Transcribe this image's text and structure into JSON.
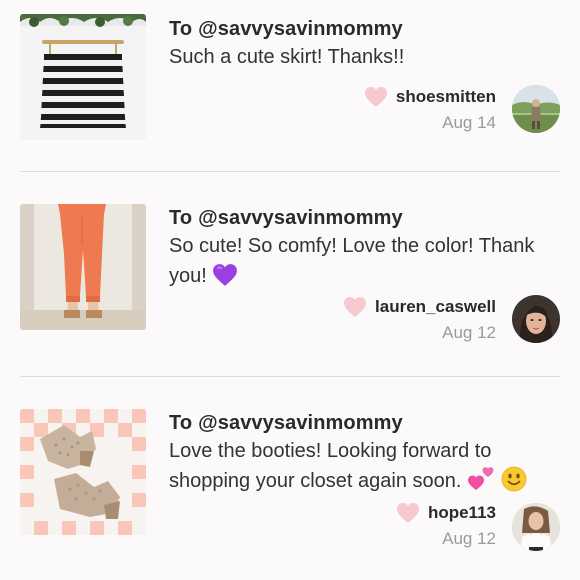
{
  "notes": [
    {
      "to_prefix": "To",
      "recipient": "@savvysavinmommy",
      "message": "Such a cute skirt! Thanks!!",
      "username": "shoesmitten",
      "date": "Aug 14",
      "thumbnail_icon": "striped-skirt-photo",
      "avatar_icon": "outdoor-person-photo"
    },
    {
      "to_prefix": "To",
      "recipient": "@savvysavinmommy",
      "message": "So cute! So comfy! Love the color! Thank you!",
      "emoji": "purple-heart",
      "username": "lauren_caswell",
      "date": "Aug 12",
      "thumbnail_icon": "coral-pants-photo",
      "avatar_icon": "woman-portrait-photo"
    },
    {
      "to_prefix": "To",
      "recipient": "@savvysavinmommy",
      "message": "Love the booties! Looking forward to shopping your closet again soon.",
      "emoji": "two-hearts-smiley",
      "username": "hope113",
      "date": "Aug 12",
      "thumbnail_icon": "tan-booties-photo",
      "avatar_icon": "woman-white-top-photo"
    }
  ],
  "colors": {
    "heart": "#f6c9cf",
    "divider": "#dcdcdc",
    "muted_text": "#9a9a9a",
    "background": "#fbf9fa"
  }
}
